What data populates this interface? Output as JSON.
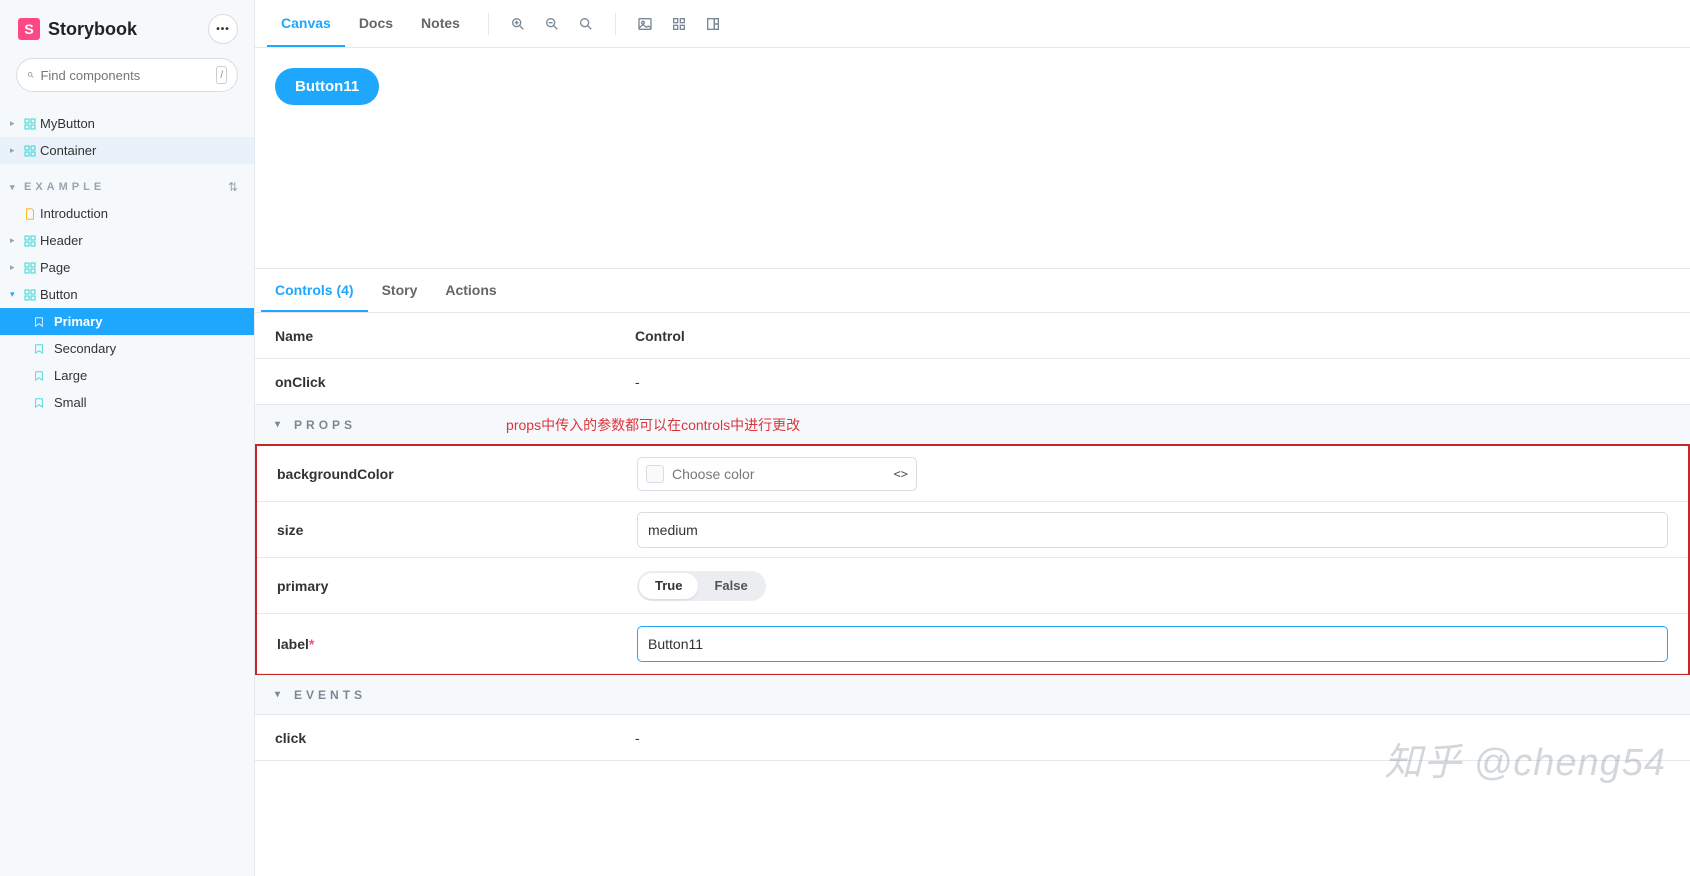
{
  "brand": {
    "name": "Storybook",
    "logo_letter": "S"
  },
  "search": {
    "placeholder": "Find components",
    "shortcut": "/"
  },
  "sidebar": {
    "top_items": [
      {
        "label": "MyButton"
      },
      {
        "label": "Container"
      }
    ],
    "section_label": "EXAMPLE",
    "example_items": [
      {
        "label": "Introduction",
        "type": "doc"
      },
      {
        "label": "Header",
        "type": "component"
      },
      {
        "label": "Page",
        "type": "component"
      },
      {
        "label": "Button",
        "type": "component",
        "expanded": true
      }
    ],
    "button_stories": [
      {
        "label": "Primary",
        "active": true
      },
      {
        "label": "Secondary"
      },
      {
        "label": "Large"
      },
      {
        "label": "Small"
      }
    ]
  },
  "toolbar": {
    "tabs": [
      {
        "label": "Canvas",
        "active": true
      },
      {
        "label": "Docs"
      },
      {
        "label": "Notes"
      }
    ]
  },
  "preview": {
    "button_label": "Button11"
  },
  "addons": {
    "tabs": [
      {
        "label": "Controls (4)",
        "active": true
      },
      {
        "label": "Story"
      },
      {
        "label": "Actions"
      }
    ],
    "headers": {
      "name": "Name",
      "control": "Control"
    },
    "rows": [
      {
        "name": "onClick",
        "control_text": "-"
      }
    ],
    "props_section": "PROPS",
    "annotation": "props中传入的参数都可以在controls中进行更改",
    "props": {
      "backgroundColor": {
        "name": "backgroundColor",
        "placeholder": "Choose color"
      },
      "size": {
        "name": "size",
        "value": "medium"
      },
      "primary": {
        "name": "primary",
        "true_label": "True",
        "false_label": "False"
      },
      "label": {
        "name": "label",
        "value": "Button11"
      }
    },
    "events_section": "EVENTS",
    "events": [
      {
        "name": "click",
        "control_text": "-"
      }
    ]
  },
  "watermark": "知乎 @cheng54"
}
